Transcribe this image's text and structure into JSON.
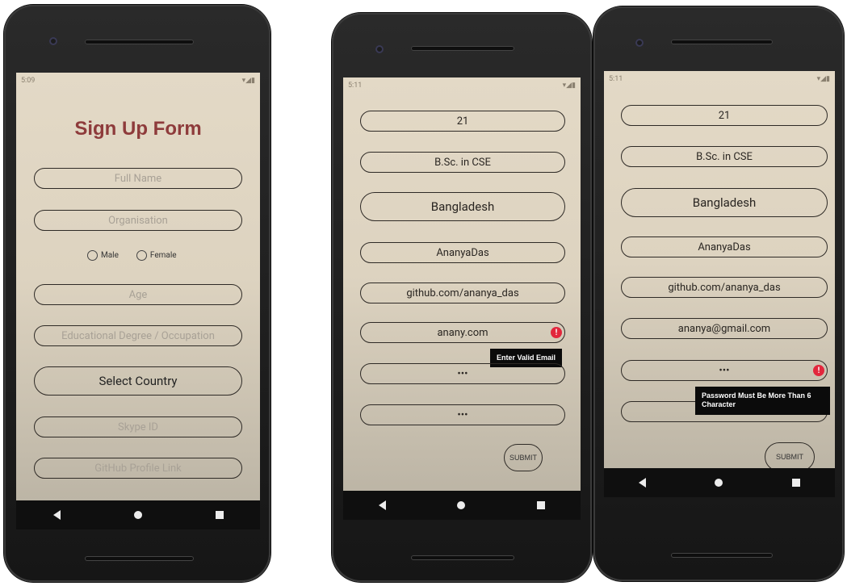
{
  "phone1": {
    "status_time": "5:09",
    "title": "Sign Up Form",
    "fields": {
      "full_name": "Full Name",
      "organisation": "Organisation",
      "age": "Age",
      "education": "Educational Degree / Occupation",
      "country": "Select Country",
      "skype": "Skype ID",
      "github": "GitHub Profile Link"
    },
    "gender": {
      "male": "Male",
      "female": "Female"
    }
  },
  "phone2": {
    "status_time": "5:11",
    "fields": {
      "age": "21",
      "education": "B.Sc. in CSE",
      "country": "Bangladesh",
      "skype": "AnanyaDas",
      "github": "github.com/ananya_das",
      "email": "anany.com",
      "password": "•••",
      "confirm": "•••"
    },
    "error_text": "Enter Valid Email",
    "submit": "SUBMIT"
  },
  "phone3": {
    "status_time": "5:11",
    "fields": {
      "age": "21",
      "education": "B.Sc. in CSE",
      "country": "Bangladesh",
      "skype": "AnanyaDas",
      "github": "github.com/ananya_das",
      "email": "ananya@gmail.com",
      "password": "•••"
    },
    "error_text": "Password Must Be More Than 6 Character",
    "submit": "SUBMIT"
  },
  "icons": {
    "error": "!"
  },
  "colors": {
    "title": "#8e3b3b",
    "error": "#e2263c",
    "tooltip_bg": "#0b0b0b"
  }
}
